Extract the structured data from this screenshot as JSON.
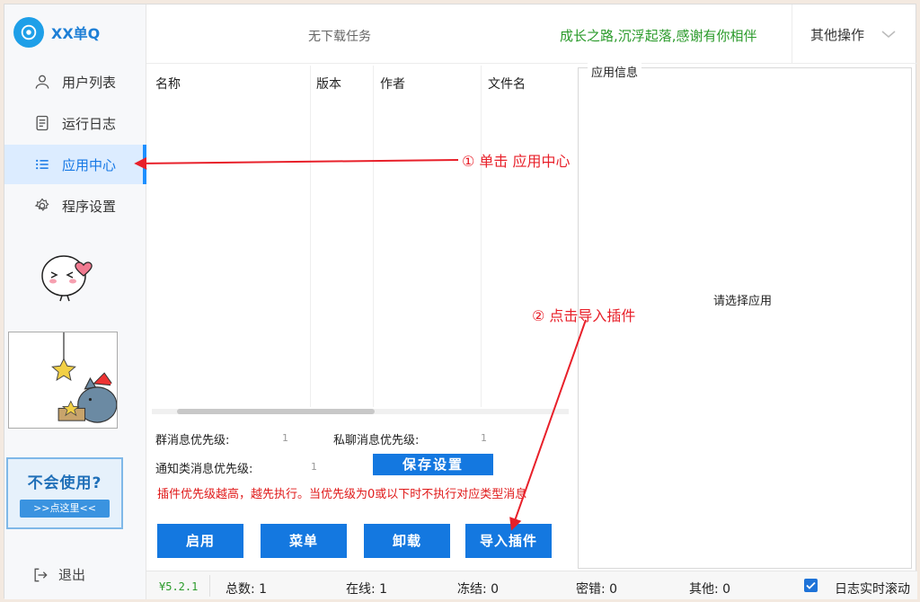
{
  "app": {
    "title": "XX单Q"
  },
  "sidebar": {
    "items": [
      {
        "label": "用户列表",
        "icon": "user-icon"
      },
      {
        "label": "运行日志",
        "icon": "log-icon"
      },
      {
        "label": "应用中心",
        "icon": "list-icon",
        "active": true
      },
      {
        "label": "程序设置",
        "icon": "gear-icon"
      }
    ],
    "help_title": "不会使用?",
    "help_link": ">>点这里<<",
    "logout": "退出"
  },
  "topbar": {
    "task_status": "无下载任务",
    "motto": "成长之路,沉浮起落,感谢有你相伴",
    "other_ops": "其他操作"
  },
  "table": {
    "columns": [
      "名称",
      "版本",
      "作者",
      "文件名"
    ],
    "rows": []
  },
  "app_info": {
    "title": "应用信息",
    "empty_text": "请选择应用"
  },
  "priority": {
    "group_label": "群消息优先级:",
    "group_value": "1",
    "private_label": "私聊消息优先级:",
    "private_value": "1",
    "notify_label": "通知类消息优先级:",
    "notify_value": "1",
    "save_label": "保存设置",
    "hint": "插件优先级越高，越先执行。当优先级为0或以下时不执行对应类型消息"
  },
  "actions": {
    "enable": "启用",
    "menu": "菜单",
    "uninstall": "卸载",
    "import": "导入插件"
  },
  "statusbar": {
    "version": "¥5.2.1",
    "total": "总数: 1",
    "online": "在线: 1",
    "frozen": "冻结: 0",
    "pwd_error": "密错: 0",
    "other": "其他: 0",
    "log_scroll_label": "日志实时滚动",
    "log_scroll_checked": true
  },
  "annotations": {
    "step1": "① 单击 应用中心",
    "step2": "② 点击导入插件"
  },
  "colors": {
    "accent": "#1478e0",
    "motto": "#2a9a2a",
    "hint": "#e01a1a",
    "annotation": "#e8202a"
  }
}
